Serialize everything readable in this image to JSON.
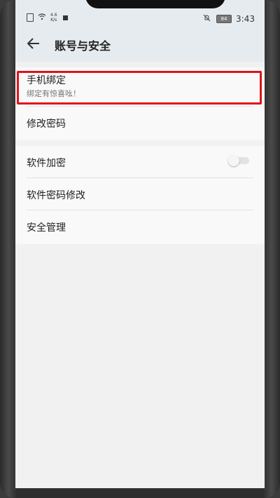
{
  "status_bar": {
    "speed_value": "4.6",
    "speed_unit": "K/s",
    "battery": "84",
    "time": "3:43"
  },
  "header": {
    "title": "账号与安全"
  },
  "sections": {
    "first": [
      {
        "label": "手机绑定",
        "subtitle": "绑定有惊喜吆！",
        "highlighted": true
      },
      {
        "label": "修改密码"
      }
    ],
    "second": [
      {
        "label": "软件加密",
        "toggle_on": false
      },
      {
        "label": "软件密码修改"
      },
      {
        "label": "安全管理"
      }
    ]
  },
  "colors": {
    "highlight_border": "#e0131a",
    "header_bg": "#e6ebef"
  },
  "icons": {
    "back": "back-arrow-icon",
    "wifi": "wifi-icon",
    "bell": "bell-off-icon",
    "battery": "battery-icon"
  }
}
